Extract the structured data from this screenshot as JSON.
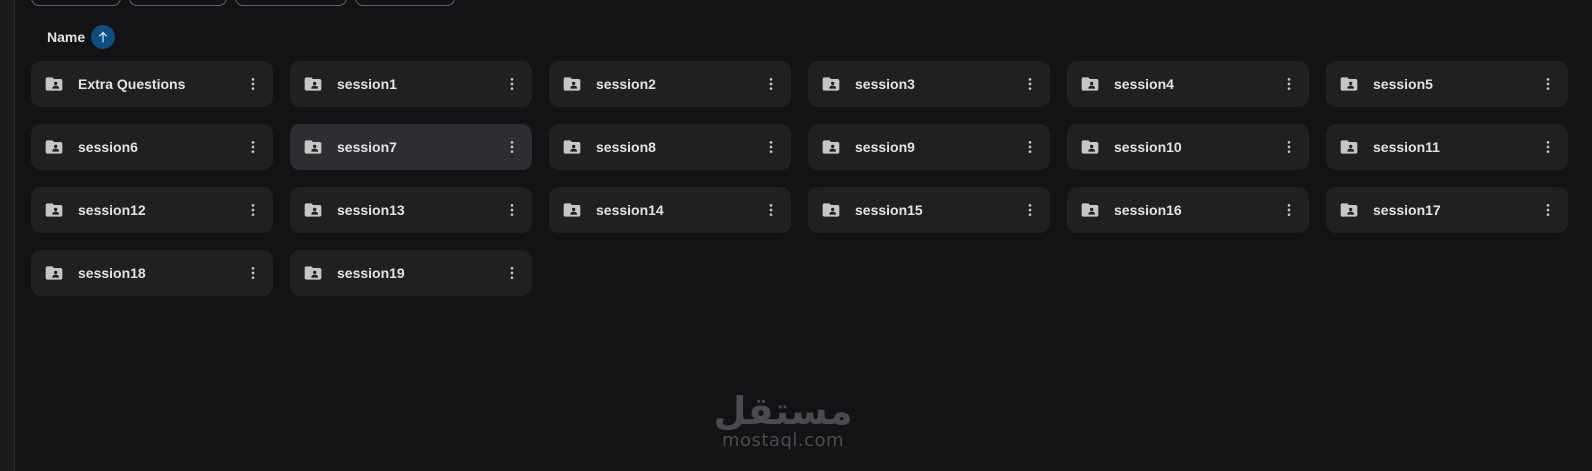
{
  "header": {
    "sort_label": "Name",
    "sort_direction": "ascending"
  },
  "colors": {
    "background": "#131316",
    "card": "#1f2022",
    "card_hover": "#2d2e31",
    "accent": "#0b4f82",
    "text": "#e3e3e3"
  },
  "icons": {
    "folder": "shared-folder-icon",
    "more": "more-vert-icon",
    "sort": "arrow-up-icon"
  },
  "folders": [
    {
      "name": "Extra Questions"
    },
    {
      "name": "session1"
    },
    {
      "name": "session2"
    },
    {
      "name": "session3"
    },
    {
      "name": "session4"
    },
    {
      "name": "session5"
    },
    {
      "name": "session6"
    },
    {
      "name": "session7",
      "hovered": true
    },
    {
      "name": "session8"
    },
    {
      "name": "session9"
    },
    {
      "name": "session10"
    },
    {
      "name": "session11"
    },
    {
      "name": "session12"
    },
    {
      "name": "session13"
    },
    {
      "name": "session14"
    },
    {
      "name": "session15"
    },
    {
      "name": "session16"
    },
    {
      "name": "session17"
    },
    {
      "name": "session18"
    },
    {
      "name": "session19"
    }
  ],
  "watermark": {
    "arabic": "مستقل",
    "latin": "mostaql.com"
  }
}
